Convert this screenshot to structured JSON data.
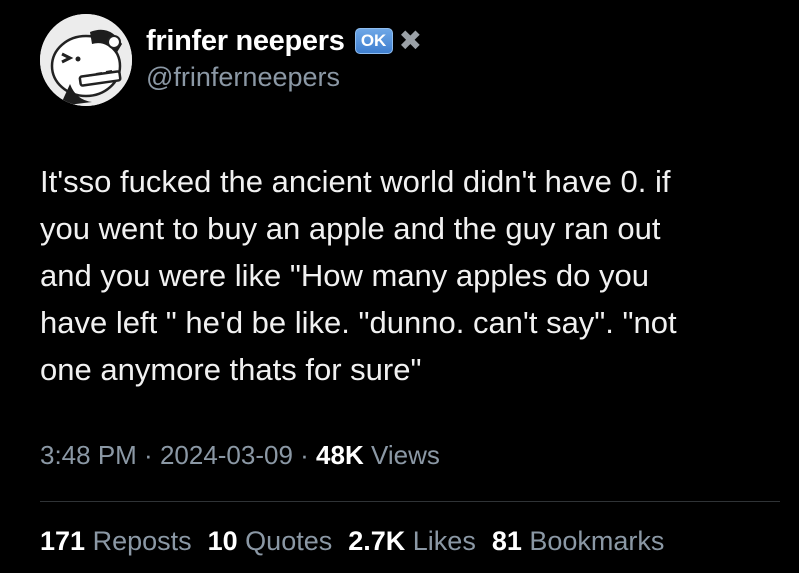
{
  "author": {
    "display_name": "frinfer neepers",
    "badge_text": "OK",
    "badge_color": "#4a8ad8",
    "extra_icon": "x-mark-icon",
    "handle": "@frinferneepers"
  },
  "tweet": {
    "text": "It'sso fucked the ancient world didn't have 0. if\nyou went to buy an apple and the guy ran out\nand you were like \"How many apples do you\nhave left \" he'd be like. \"dunno. can't say\". \"not\none anymore thats for sure\""
  },
  "meta": {
    "time": "3:48 PM",
    "separator": " · ",
    "date": "2024-03-09",
    "views_count": "48K",
    "views_label": " Views"
  },
  "stats": {
    "reposts": {
      "count": "171",
      "label": " Reposts"
    },
    "quotes": {
      "count": "10",
      "label": " Quotes"
    },
    "likes": {
      "count": "2.7K",
      "label": " Likes"
    },
    "bookmarks": {
      "count": "81",
      "label": " Bookmarks"
    }
  }
}
